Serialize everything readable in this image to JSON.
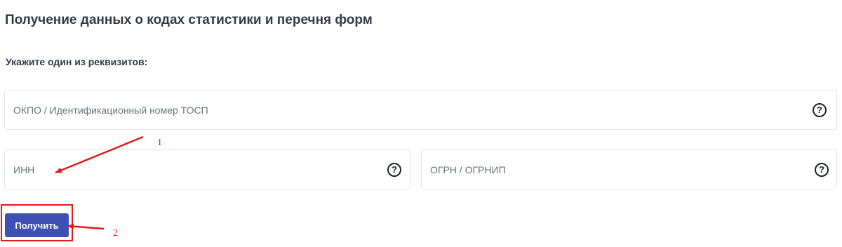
{
  "page": {
    "title": "Получение данных о кодах статистики и перечня форм",
    "subtitle": "Укажите один из реквизитов:"
  },
  "fields": {
    "okpo": {
      "placeholder": "ОКПО / Идентификационный номер ТОСП",
      "help": "?"
    },
    "inn": {
      "placeholder": "ИНН",
      "help": "?"
    },
    "ogrn": {
      "placeholder": "ОГРН / ОГРНИП",
      "help": "?"
    }
  },
  "actions": {
    "submit_label": "Получить"
  },
  "annotations": {
    "step1": "1",
    "step2": "2"
  },
  "colors": {
    "primary_button": "#3e50b4",
    "annotation_red": "#e31b1b",
    "text": "#333a44",
    "border": "#e3e6ea"
  },
  "icons": [
    "help-circle-icon",
    "annotation-arrow-icon"
  ]
}
